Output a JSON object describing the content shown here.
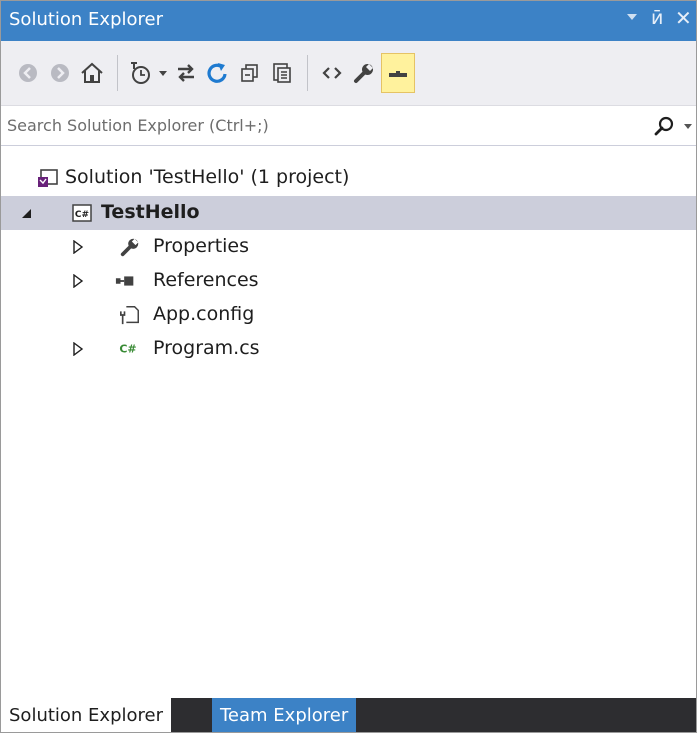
{
  "window": {
    "title": "Solution Explorer",
    "accent_color": "#3c82c6"
  },
  "toolbar": {
    "buttons": [
      {
        "icon": "back-arrow-icon"
      },
      {
        "icon": "forward-arrow-icon"
      },
      {
        "icon": "home-icon"
      },
      {
        "icon": "pending-changes-filter-icon"
      },
      {
        "icon": "sync-with-active-document-icon"
      },
      {
        "icon": "refresh-icon"
      },
      {
        "icon": "collapse-all-icon"
      },
      {
        "icon": "show-all-files-icon"
      },
      {
        "icon": "view-code-icon"
      },
      {
        "icon": "properties-wrench-icon"
      },
      {
        "icon": "preview-selected-items-icon",
        "active": true
      }
    ]
  },
  "search": {
    "placeholder": "Search Solution Explorer (Ctrl+;)"
  },
  "tree": {
    "solution": {
      "label": "Solution 'TestHello' (1 project)",
      "icon": "solution-icon"
    },
    "project": {
      "label": "TestHello",
      "icon": "csharp-project-icon",
      "expanded": true,
      "selected": true
    },
    "children": [
      {
        "label": "Properties",
        "icon": "wrench-icon",
        "expandable": true
      },
      {
        "label": "References",
        "icon": "references-icon",
        "expandable": true
      },
      {
        "label": "App.config",
        "icon": "config-file-icon",
        "expandable": false
      },
      {
        "label": "Program.cs",
        "icon": "csharp-file-icon",
        "expandable": true
      }
    ]
  },
  "tabs": [
    {
      "label": "Solution Explorer",
      "active": true
    },
    {
      "label": "Team Explorer",
      "active": false
    }
  ]
}
